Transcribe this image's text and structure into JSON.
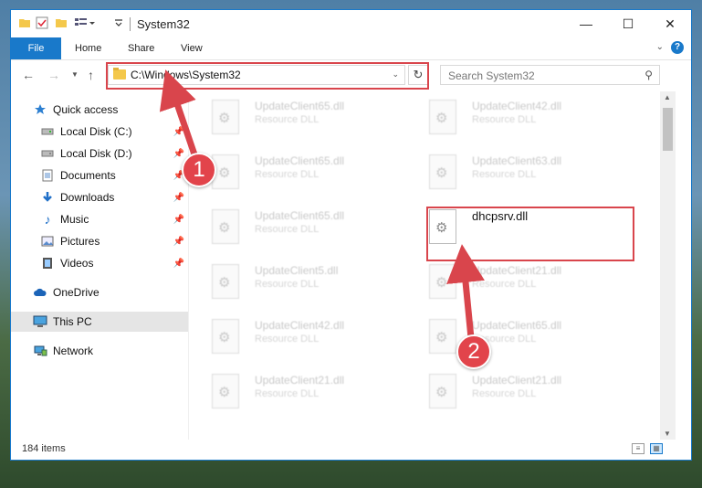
{
  "window": {
    "title": "System32",
    "controls": {
      "minimize": "—",
      "maximize": "☐",
      "close": "✕"
    }
  },
  "ribbon": {
    "tabs": [
      "File",
      "Home",
      "Share",
      "View"
    ],
    "help": "?"
  },
  "navbar": {
    "address_path": "C:\\Windows\\System32",
    "search_placeholder": "Search System32"
  },
  "sidebar": {
    "items": [
      {
        "label": "Quick access",
        "icon": "star-icon",
        "pinned": false
      },
      {
        "label": "Local Disk (C:)",
        "icon": "drive-icon",
        "pinned": true
      },
      {
        "label": "Local Disk (D:)",
        "icon": "drive-icon",
        "pinned": true
      },
      {
        "label": "Documents",
        "icon": "documents-icon",
        "pinned": true
      },
      {
        "label": "Downloads",
        "icon": "download-icon",
        "pinned": true
      },
      {
        "label": "Music",
        "icon": "music-icon",
        "pinned": true
      },
      {
        "label": "Pictures",
        "icon": "pictures-icon",
        "pinned": true
      },
      {
        "label": "Videos",
        "icon": "videos-icon",
        "pinned": true
      },
      {
        "label": "OneDrive",
        "icon": "cloud-icon",
        "pinned": false
      },
      {
        "label": "This PC",
        "icon": "computer-icon",
        "pinned": false,
        "selected": true
      },
      {
        "label": "Network",
        "icon": "network-icon",
        "pinned": false
      }
    ]
  },
  "files": {
    "left_column": [
      {
        "name": "UpdateClient65.dll",
        "type": "Resource DLL"
      },
      {
        "name": "UpdateClient65.dll",
        "type": "Resource DLL"
      },
      {
        "name": "UpdateClient65.dll",
        "type": "Resource DLL"
      },
      {
        "name": "UpdateClient5.dll",
        "type": "Resource DLL"
      },
      {
        "name": "UpdateClient42.dll",
        "type": "Resource DLL"
      },
      {
        "name": "UpdateClient21.dll",
        "type": "Resource DLL"
      }
    ],
    "right_column": [
      {
        "name": "UpdateClient42.dll",
        "type": "Resource DLL"
      },
      {
        "name": "UpdateClient63.dll",
        "type": "Resource DLL"
      },
      {
        "name": "dhcpsrv.dll",
        "type": ""
      },
      {
        "name": "UpdateClient21.dll",
        "type": "Resource DLL"
      },
      {
        "name": "UpdateClient65.dll",
        "type": "Resource DLL"
      },
      {
        "name": "UpdateClient21.dll",
        "type": "Resource DLL"
      }
    ]
  },
  "status": {
    "item_count": "184 items"
  },
  "annotations": {
    "step1": "1",
    "step2": "2",
    "accent_color": "#d9454c"
  }
}
